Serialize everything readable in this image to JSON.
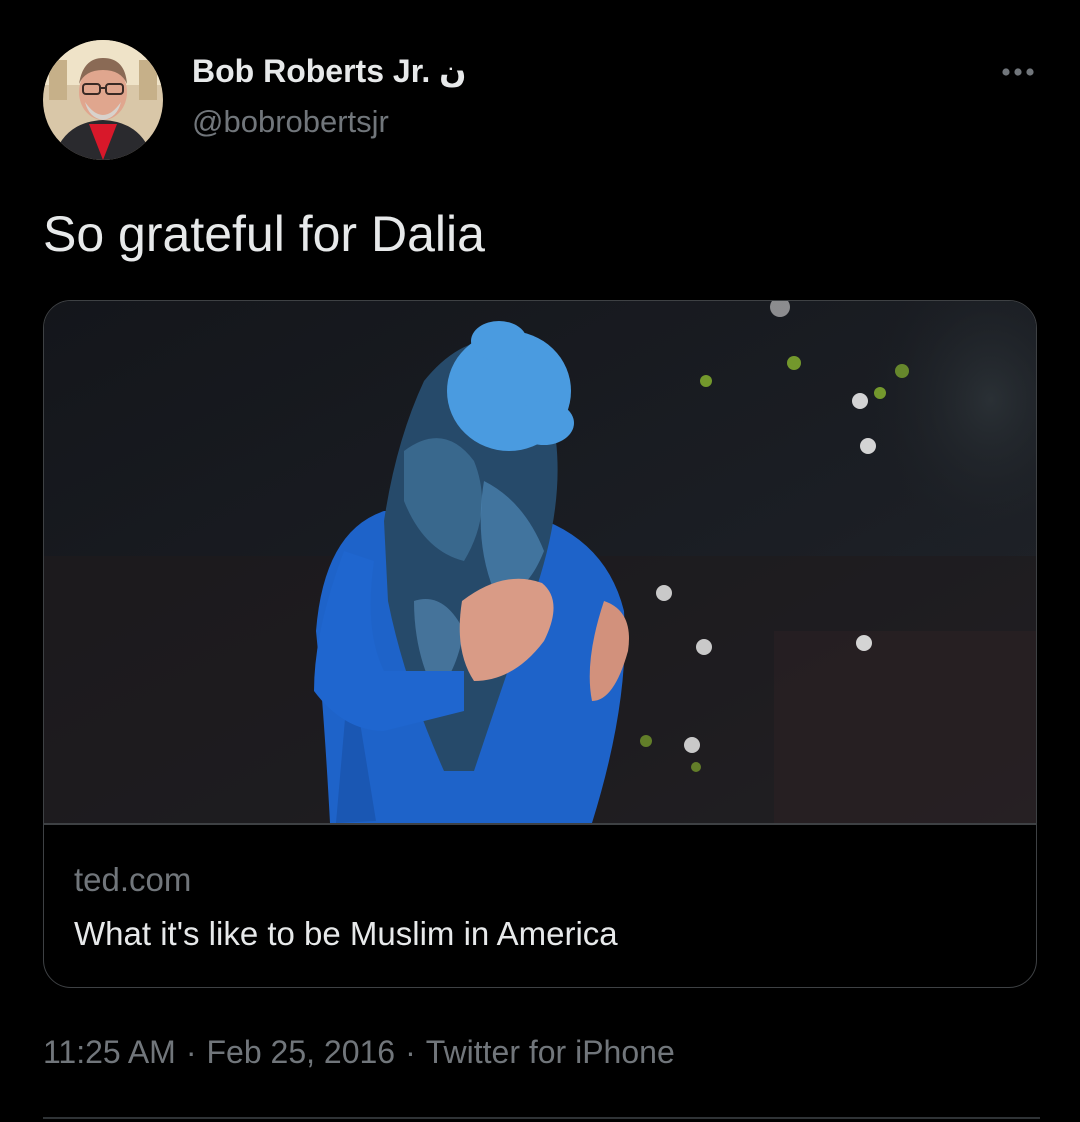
{
  "tweet": {
    "author": {
      "display_name": "Bob Roberts Jr. ن",
      "handle": "@bobrobertsjr",
      "avatar_icon": "profile-photo"
    },
    "more_icon": "more-horizontal-icon",
    "text": "So grateful for Dalia",
    "card": {
      "image_description_icon": "link-preview-image",
      "domain": "ted.com",
      "title": "What it's like to be Muslim in America"
    },
    "meta": {
      "time": "11:25 AM",
      "separator": "·",
      "date": "Feb 25, 2016",
      "source": "Twitter for iPhone"
    }
  },
  "colors": {
    "background": "#000000",
    "primary_text": "#e7e9ea",
    "secondary_text": "#71767b",
    "border": "#3e4144",
    "face_blur": "#4a9be0"
  }
}
